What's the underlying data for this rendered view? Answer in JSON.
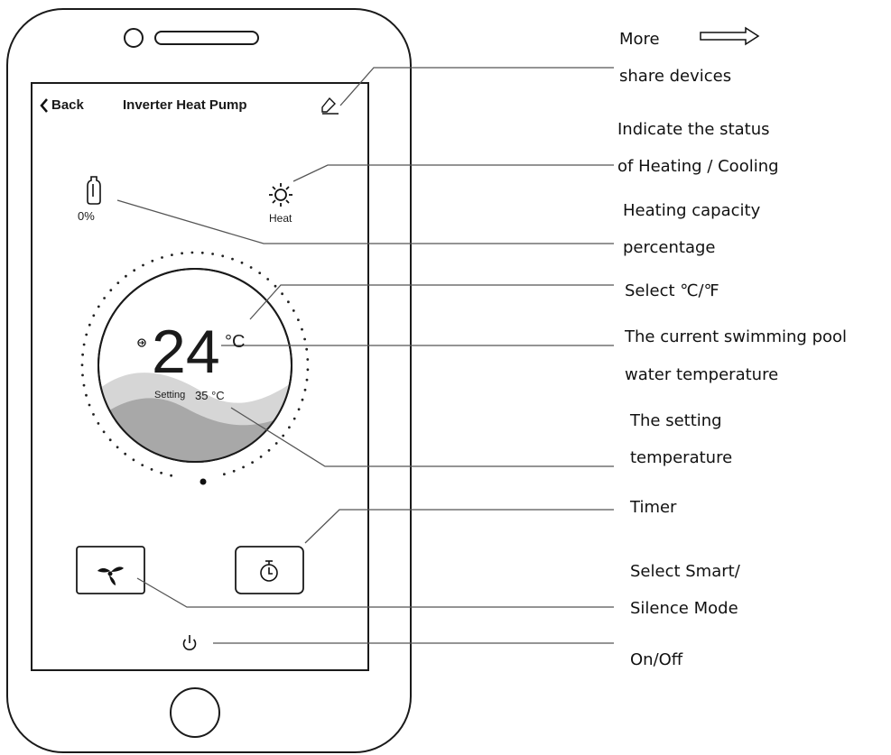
{
  "phone": {
    "header": {
      "back_label": "Back",
      "title": "Inverter Heat Pump",
      "edit_icon": "pencil-icon"
    },
    "capacity": {
      "icon": "tank-icon",
      "value_label": "0%"
    },
    "mode": {
      "icon": "sun-icon",
      "label": "Heat"
    },
    "dial": {
      "current_temp": "24",
      "unit_label": "°C",
      "setting_label": "Setting",
      "setting_value": "35 °C"
    },
    "buttons": {
      "fan_icon": "fan-icon",
      "timer_icon": "stopwatch-icon",
      "power_icon": "power-icon"
    }
  },
  "annotations": {
    "more": "More",
    "share": "share devices",
    "status_line1": "Indicate the status",
    "status_line2": "of Heating / Cooling",
    "capacity_line1": "Heating capacity",
    "capacity_line2": "percentage",
    "unit_select": "Select ℃/℉",
    "current_line1": "The current swimming pool",
    "current_line2": "water temperature",
    "setting_line1": "The setting",
    "setting_line2": "temperature",
    "timer": "Timer",
    "mode_line1": "Select Smart/",
    "mode_line2": "Silence Mode",
    "onoff": "On/Off"
  },
  "colors": {
    "line": "#111111",
    "leader": "#555555",
    "wave_light": "#d6d6d6",
    "wave_dark": "#a8a8a8"
  }
}
